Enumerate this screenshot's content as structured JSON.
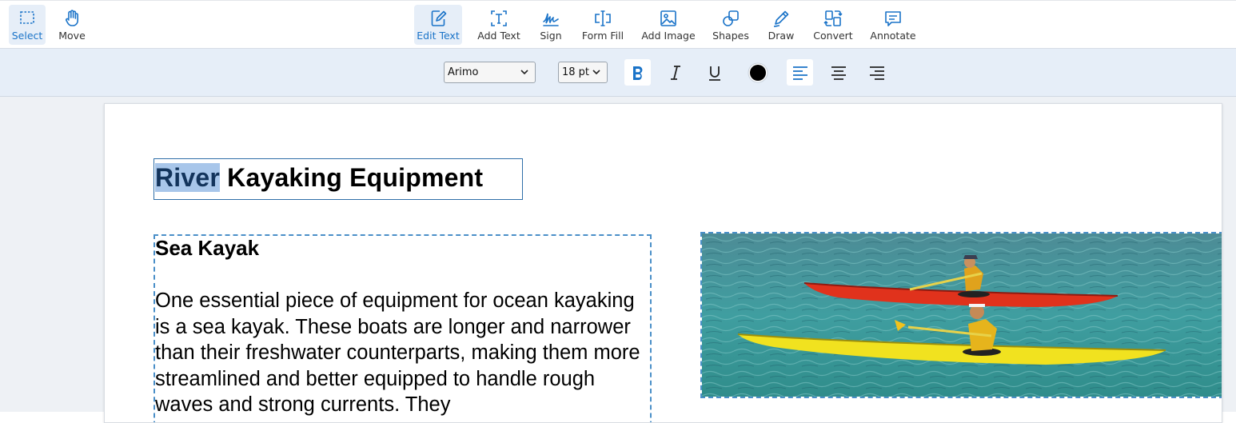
{
  "toolbar": {
    "tools": [
      {
        "label": "Select",
        "icon": "selection-icon",
        "active": true
      },
      {
        "label": "Move",
        "icon": "hand-icon"
      },
      {
        "label": "Edit Text",
        "icon": "edit-text-icon",
        "active": true
      },
      {
        "label": "Add Text",
        "icon": "add-text-icon"
      },
      {
        "label": "Sign",
        "icon": "signature-icon"
      },
      {
        "label": "Form Fill",
        "icon": "form-fill-icon"
      },
      {
        "label": "Add Image",
        "icon": "image-icon"
      },
      {
        "label": "Shapes",
        "icon": "shapes-icon"
      },
      {
        "label": "Draw",
        "icon": "pen-icon"
      },
      {
        "label": "Convert",
        "icon": "convert-icon"
      },
      {
        "label": "Annotate",
        "icon": "comment-icon"
      }
    ]
  },
  "format": {
    "font": "Arimo",
    "size": "18 pt",
    "bold_active": true,
    "align_left_active": true,
    "color": "#000000"
  },
  "document": {
    "title_selected": "River",
    "title_rest": " Kayaking Equipment",
    "heading": "Sea Kayak",
    "paragraph": "One essential piece of equipment for ocean kayaking is a sea kayak. These boats are longer and narrower than their freshwater counterparts, making them more streamlined and better equipped to handle rough waves and strong currents. They",
    "image_alt": "two-kayakers-photo"
  },
  "colors": {
    "accent": "#1a73c8",
    "formatbar_bg": "#e6eef8",
    "selection_highlight": "#a8c6ea"
  }
}
